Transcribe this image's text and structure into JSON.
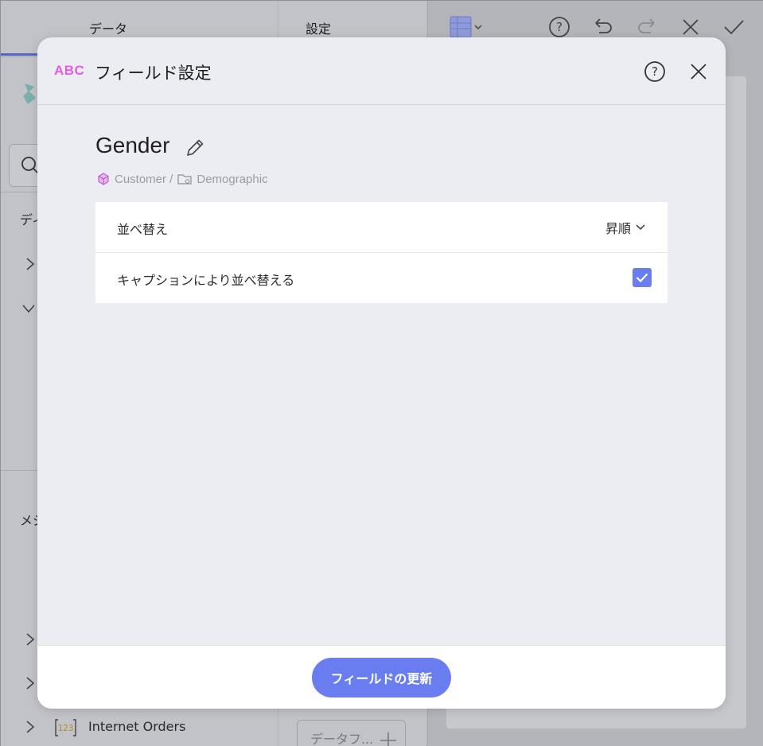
{
  "background": {
    "tabs": {
      "data": "データ",
      "settings": "設定"
    },
    "left_labels": {
      "dimensions": "ディ",
      "measures": "メジ"
    },
    "internet_orders": "Internet Orders",
    "number_badge": "123",
    "add_data_button": "データフ..."
  },
  "dialog": {
    "type_icon": "ABC",
    "title": "フィールド設定",
    "field_name": "Gender",
    "breadcrumb": {
      "model": "Customer /",
      "folder": "Demographic"
    },
    "rows": {
      "sort_label": "並べ替え",
      "sort_value": "昇順",
      "caption_sort_label": "キャプションにより並べ替える",
      "caption_sort_checked": true
    },
    "update_button": "フィールドの更新"
  },
  "colors": {
    "accent": "#6a7df0",
    "abc_icon": "#e35ee0",
    "modal_bg": "#ecedf2"
  },
  "icons": [
    "help-icon",
    "close-icon",
    "pencil-icon",
    "cube-icon",
    "folder-icon",
    "chevron-down-icon",
    "check-icon",
    "undo-icon",
    "redo-icon",
    "table-icon"
  ]
}
